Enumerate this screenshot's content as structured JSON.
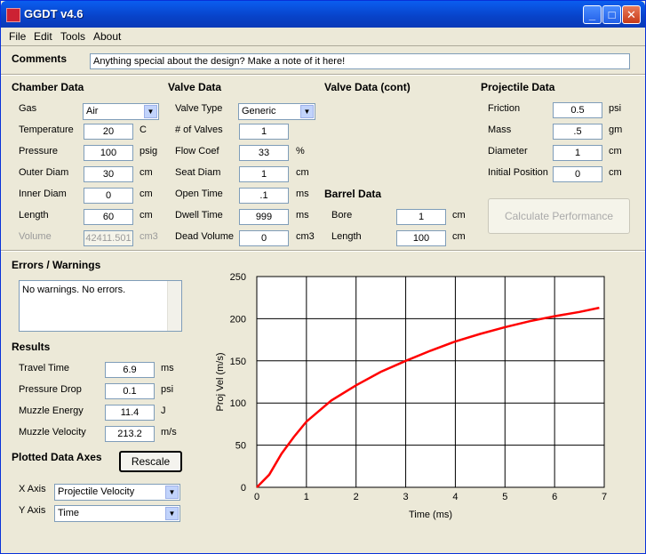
{
  "window": {
    "title": "GGDT v4.6"
  },
  "menu": [
    "File",
    "Edit",
    "Tools",
    "About"
  ],
  "comments": {
    "label": "Comments",
    "value": "Anything special about the design?  Make a note of it here!"
  },
  "chamber": {
    "title": "Chamber Data",
    "gas": {
      "label": "Gas",
      "value": "Air"
    },
    "temperature": {
      "label": "Temperature",
      "value": "20",
      "unit": "C"
    },
    "pressure": {
      "label": "Pressure",
      "value": "100",
      "unit": "psig"
    },
    "outer_diam": {
      "label": "Outer Diam",
      "value": "30",
      "unit": "cm"
    },
    "inner_diam": {
      "label": "Inner Diam",
      "value": "0",
      "unit": "cm"
    },
    "length": {
      "label": "Length",
      "value": "60",
      "unit": "cm"
    },
    "volume": {
      "label": "Volume",
      "value": "42411.501",
      "unit": "cm3"
    }
  },
  "valve": {
    "title": "Valve Data",
    "type": {
      "label": "Valve Type",
      "value": "Generic"
    },
    "num": {
      "label": "# of Valves",
      "value": "1"
    },
    "flow": {
      "label": "Flow Coef",
      "value": "33",
      "unit": "%"
    },
    "seat": {
      "label": "Seat Diam",
      "value": "1",
      "unit": "cm"
    },
    "open": {
      "label": "Open Time",
      "value": ".1",
      "unit": "ms"
    },
    "dwell": {
      "label": "Dwell Time",
      "value": "999",
      "unit": "ms"
    },
    "dead": {
      "label": "Dead Volume",
      "value": "0",
      "unit": "cm3"
    }
  },
  "valve_cont": {
    "title": "Valve Data (cont)"
  },
  "barrel": {
    "title": "Barrel Data",
    "bore": {
      "label": "Bore",
      "value": "1",
      "unit": "cm"
    },
    "length": {
      "label": "Length",
      "value": "100",
      "unit": "cm"
    }
  },
  "projectile": {
    "title": "Projectile Data",
    "friction": {
      "label": "Friction",
      "value": "0.5",
      "unit": "psi"
    },
    "mass": {
      "label": "Mass",
      "value": ".5",
      "unit": "gm"
    },
    "diameter": {
      "label": "Diameter",
      "value": "1",
      "unit": "cm"
    },
    "init_pos": {
      "label": "Initial Position",
      "value": "0",
      "unit": "cm"
    }
  },
  "calc_button": "Calculate Performance",
  "errors": {
    "title": "Errors / Warnings",
    "text": "No warnings.  No errors."
  },
  "results": {
    "title": "Results",
    "travel": {
      "label": "Travel Time",
      "value": "6.9",
      "unit": "ms"
    },
    "pdrop": {
      "label": "Pressure Drop",
      "value": "0.1",
      "unit": "psi"
    },
    "energy": {
      "label": "Muzzle Energy",
      "value": "11.4",
      "unit": "J"
    },
    "velocity": {
      "label": "Muzzle Velocity",
      "value": "213.2",
      "unit": "m/s"
    }
  },
  "axes": {
    "title": "Plotted Data Axes",
    "rescale": "Rescale",
    "x": {
      "label": "X Axis",
      "value": "Projectile Velocity"
    },
    "y": {
      "label": "Y Axis",
      "value": "Time"
    }
  },
  "chart_data": {
    "type": "line",
    "xlabel": "Time (ms)",
    "ylabel": "Proj Vel (m/s)",
    "xlim": [
      0,
      7
    ],
    "ylim": [
      0,
      250
    ],
    "xticks": [
      "0",
      "1",
      "2",
      "3",
      "4",
      "5",
      "6",
      "7"
    ],
    "yticks": [
      "0",
      "50",
      "100",
      "150",
      "200",
      "250"
    ],
    "grid": true,
    "color": "#ff0000",
    "x": [
      0,
      0.25,
      0.5,
      0.75,
      1,
      1.5,
      2,
      2.5,
      3,
      3.5,
      4,
      4.5,
      5,
      5.5,
      6,
      6.5,
      6.9
    ],
    "y": [
      0,
      15,
      40,
      60,
      78,
      103,
      121,
      137,
      150,
      162,
      173,
      182,
      190,
      197,
      203,
      208,
      213
    ]
  }
}
